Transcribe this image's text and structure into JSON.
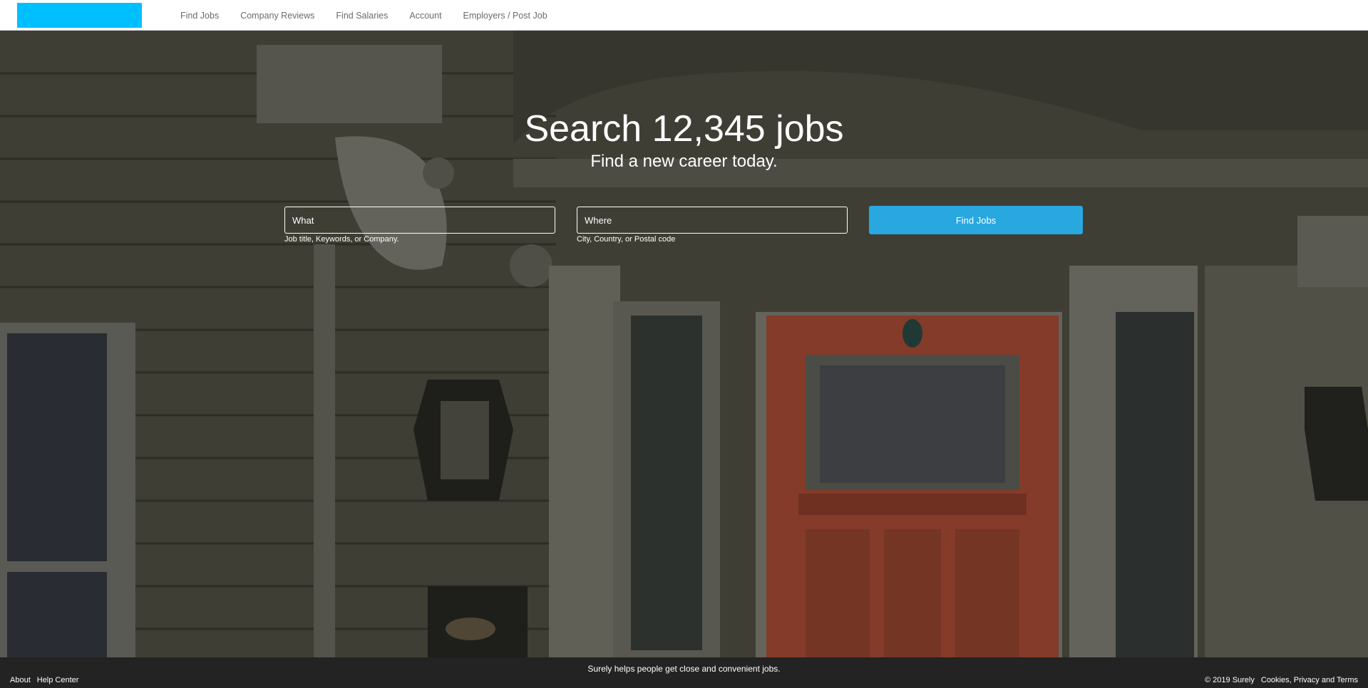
{
  "header": {
    "nav": [
      "Find Jobs",
      "Company Reviews",
      "Find Salaries",
      "Account",
      "Employers / Post Job"
    ]
  },
  "hero": {
    "title": "Search 12,345 jobs",
    "subtitle": "Find a new career today.",
    "what_placeholder": "What",
    "what_hint": "Job title, Keywords, or Company.",
    "where_placeholder": "Where",
    "where_hint": "City, Country, or Postal code",
    "button_label": "Find Jobs"
  },
  "footer": {
    "tagline": "Surely helps people get close and convenient jobs.",
    "left_links": [
      "About",
      "Help Center"
    ],
    "copyright": "© 2019 Surely",
    "terms_link": "Cookies, Privacy and Terms"
  },
  "colors": {
    "logo": "#00bfff",
    "button": "#29a8e0",
    "door": "#b8523a"
  }
}
